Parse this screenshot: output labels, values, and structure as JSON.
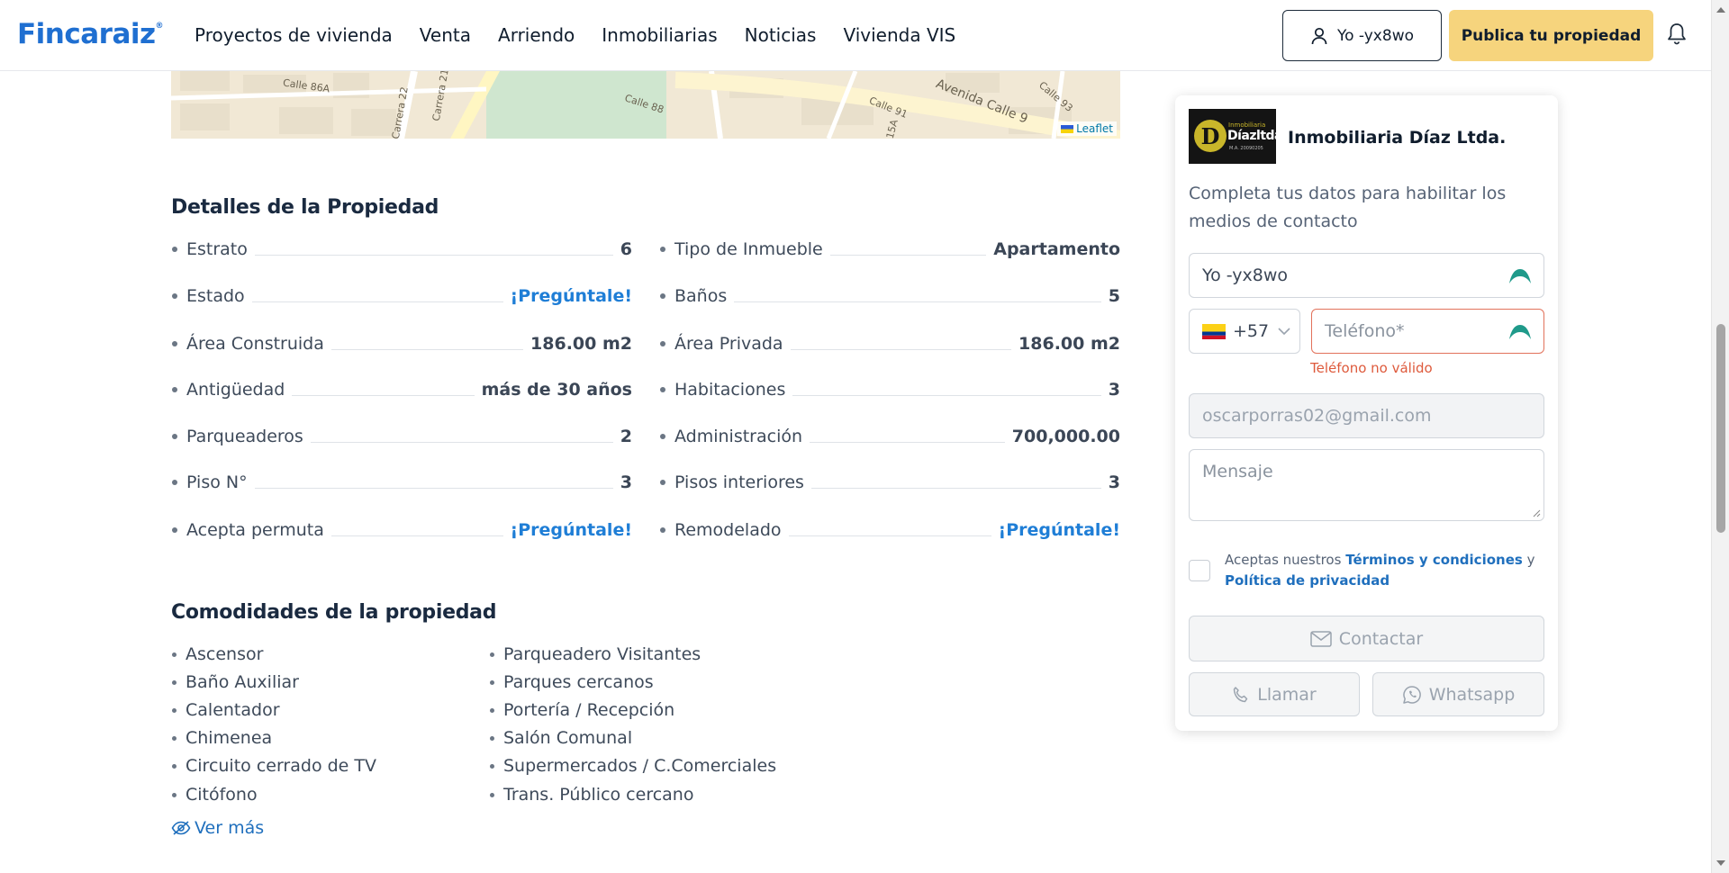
{
  "header": {
    "logo": "Fincaraiz",
    "logo_mark": "®",
    "nav": [
      "Proyectos de vivienda",
      "Venta",
      "Arriendo",
      "Inmobiliarias",
      "Noticias",
      "Vivienda VIS"
    ],
    "user_button": "Yo -yx8wo",
    "publish_button": "Publica tu propiedad",
    "user_icon": "user-icon",
    "bell_icon": "bell-icon"
  },
  "map": {
    "streets": [
      "Calle 86A",
      "Carrera 22",
      "Carrera 21",
      "Calle 88",
      "Calle 91",
      "Avenida Calle 9",
      "Calle 93",
      "15A"
    ],
    "attribution": "Leaflet"
  },
  "details": {
    "title": "Detalles de la Propiedad",
    "left": [
      {
        "label": "Estrato",
        "value": "6"
      },
      {
        "label": "Estado",
        "value": "¡Pregúntale!"
      },
      {
        "label": "Área Construida",
        "value": "186.00 m2"
      },
      {
        "label": "Antigüedad",
        "value": "más de 30 años"
      },
      {
        "label": "Parqueaderos",
        "value": "2"
      },
      {
        "label": "Piso N°",
        "value": "3"
      },
      {
        "label": "Acepta permuta",
        "value": "¡Pregúntale!"
      }
    ],
    "right": [
      {
        "label": "Tipo de Inmueble",
        "value": "Apartamento"
      },
      {
        "label": "Baños",
        "value": "5"
      },
      {
        "label": "Área Privada",
        "value": "186.00 m2"
      },
      {
        "label": "Habitaciones",
        "value": "3"
      },
      {
        "label": "Administración",
        "value": "700,000.00"
      },
      {
        "label": "Pisos interiores",
        "value": "3"
      },
      {
        "label": "Remodelado",
        "value": "¡Pregúntale!"
      }
    ]
  },
  "amenities": {
    "title": "Comodidades de la propiedad",
    "col1": [
      "Ascensor",
      "Baño Auxiliar",
      "Calentador",
      "Chimenea",
      "Circuito cerrado de TV",
      "Citófono"
    ],
    "col2": [
      "Parqueadero Visitantes",
      "Parques cercanos",
      "Portería / Recepción",
      "Salón Comunal",
      "Supermercados / C.Comerciales",
      "Trans. Público cercano"
    ],
    "see_more": "Ver más"
  },
  "contact": {
    "agency_name": "Inmobiliaria Díaz Ltda.",
    "intro": "Completa tus datos para habilitar los medios de contacto",
    "name_value": "Yo -yx8wo",
    "country_code": "+57",
    "phone_placeholder": "Teléfono*",
    "phone_error": "Teléfono no válido",
    "email_value": "oscarporras02@gmail.com",
    "message_placeholder": "Mensaje",
    "terms_prefix": "Aceptas nuestros",
    "terms_link": "Términos y condiciones",
    "terms_and": "y",
    "privacy_link": "Política de privacidad",
    "contact_button": "Contactar",
    "call_button": "Llamar",
    "whatsapp_button": "Whatsapp"
  },
  "colors": {
    "brand_blue": "#1f6fd1",
    "publish_yellow": "#f6d47d",
    "link_blue": "#1f7ed6",
    "error": "#de5a3c"
  }
}
